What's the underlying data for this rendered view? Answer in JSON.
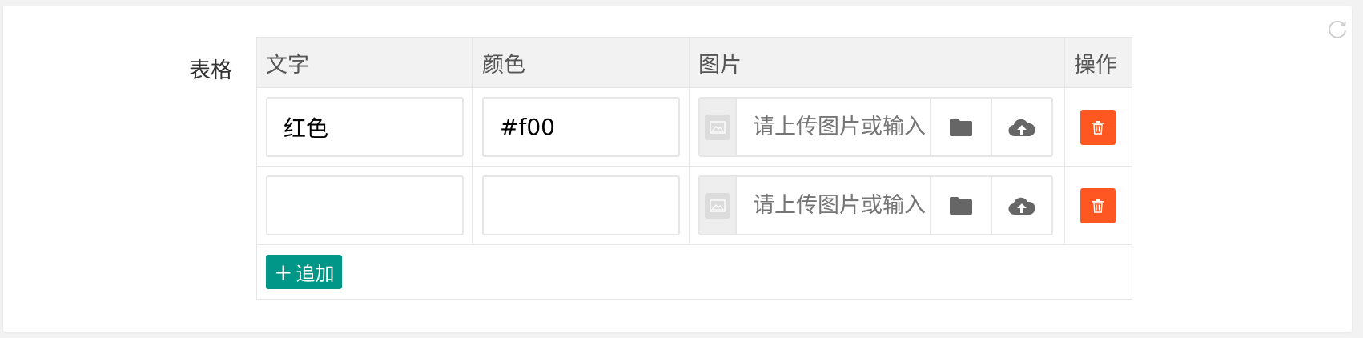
{
  "form": {
    "label": "表格"
  },
  "table": {
    "headers": {
      "text": "文字",
      "color": "颜色",
      "image": "图片",
      "op": "操作"
    },
    "rows": [
      {
        "text": "红色",
        "color": "#f00",
        "image": "",
        "image_placeholder": "请上传图片或输入"
      },
      {
        "text": "",
        "color": "",
        "image": "",
        "image_placeholder": "请上传图片或输入"
      }
    ],
    "add_label": "追加",
    "add_icon": "plus-icon"
  },
  "icons": {
    "refresh": "refresh-icon",
    "thumb": "image-placeholder-icon",
    "folder": "folder-icon",
    "upload": "cloud-upload-icon",
    "delete": "trash-icon"
  },
  "colors": {
    "delete_button": "#ff5722",
    "add_button": "#009688",
    "header_bg": "#f2f2f2",
    "border": "#e6e6e6"
  }
}
